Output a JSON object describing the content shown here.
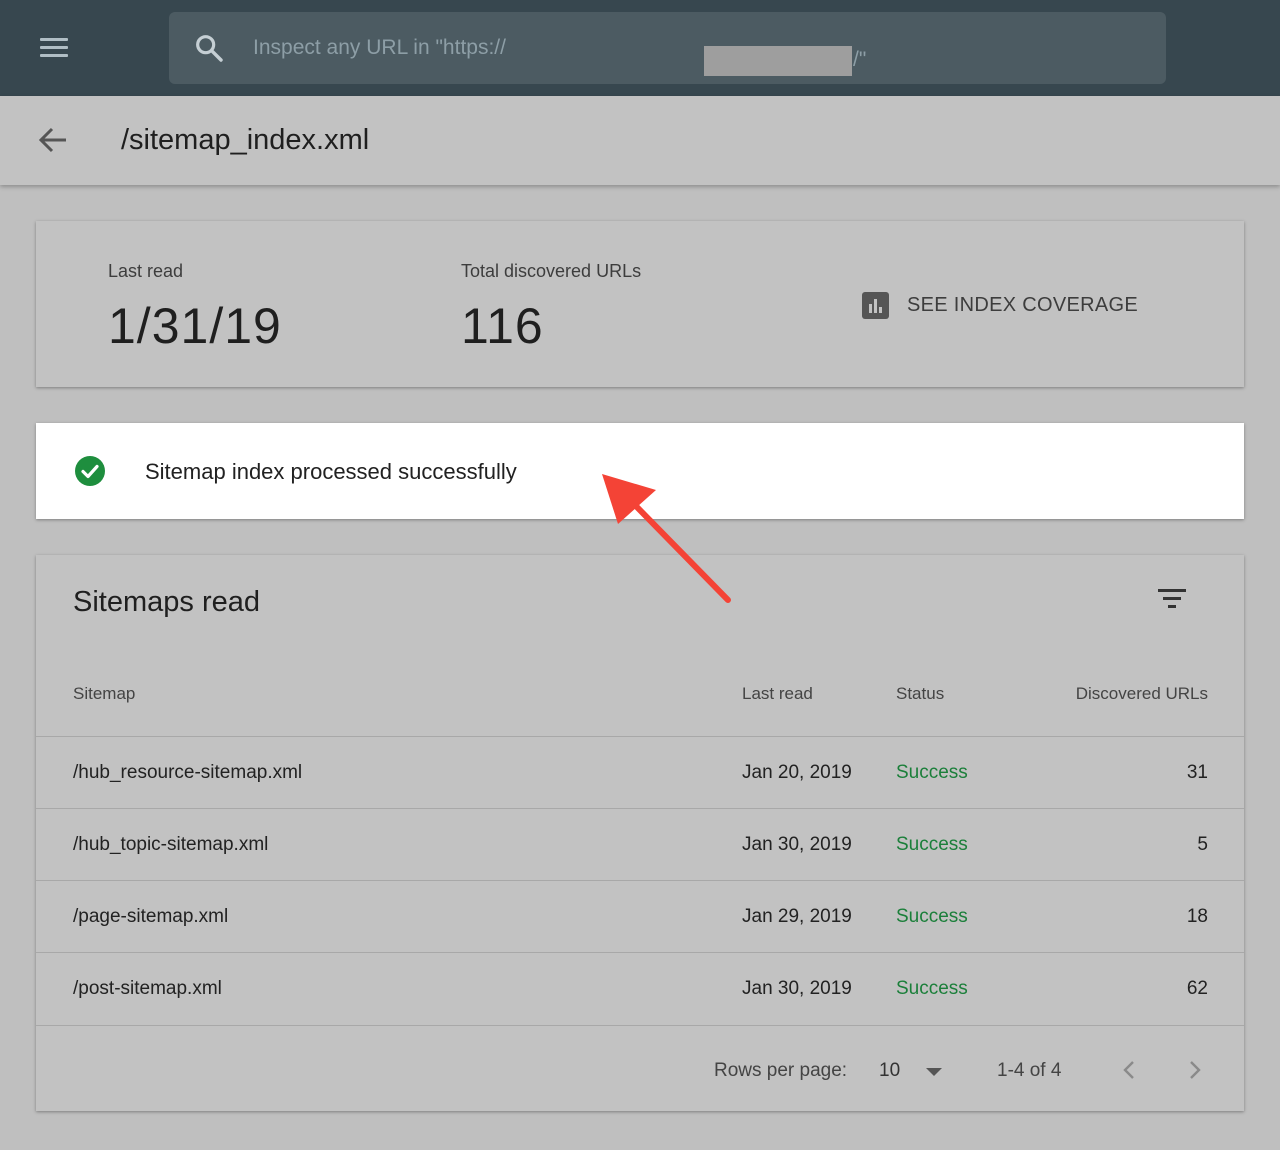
{
  "header": {
    "search_placeholder": "Inspect any URL in \"https://",
    "search_suffix": "/\""
  },
  "page": {
    "title": "/sitemap_index.xml"
  },
  "summary": {
    "last_read_label": "Last read",
    "last_read_value": "1/31/19",
    "total_label": "Total discovered URLs",
    "total_value": "116",
    "coverage_button": "SEE INDEX COVERAGE"
  },
  "status_banner": {
    "text": "Sitemap index processed successfully"
  },
  "table": {
    "title": "Sitemaps read",
    "columns": [
      "Sitemap",
      "Last read",
      "Status",
      "Discovered URLs"
    ],
    "rows": [
      {
        "sitemap": "/hub_resource-sitemap.xml",
        "last_read": "Jan 20, 2019",
        "status": "Success",
        "urls": "31"
      },
      {
        "sitemap": "/hub_topic-sitemap.xml",
        "last_read": "Jan 30, 2019",
        "status": "Success",
        "urls": "5"
      },
      {
        "sitemap": "/page-sitemap.xml",
        "last_read": "Jan 29, 2019",
        "status": "Success",
        "urls": "18"
      },
      {
        "sitemap": "/post-sitemap.xml",
        "last_read": "Jan 30, 2019",
        "status": "Success",
        "urls": "62"
      }
    ],
    "footer": {
      "rows_per_page_label": "Rows per page:",
      "rows_per_page_value": "10",
      "range": "1-4 of 4"
    }
  },
  "colors": {
    "topbar": "#37474f",
    "success": "#1b7f3a",
    "check": "#1e8e3e",
    "annotation_arrow": "#f44336"
  }
}
